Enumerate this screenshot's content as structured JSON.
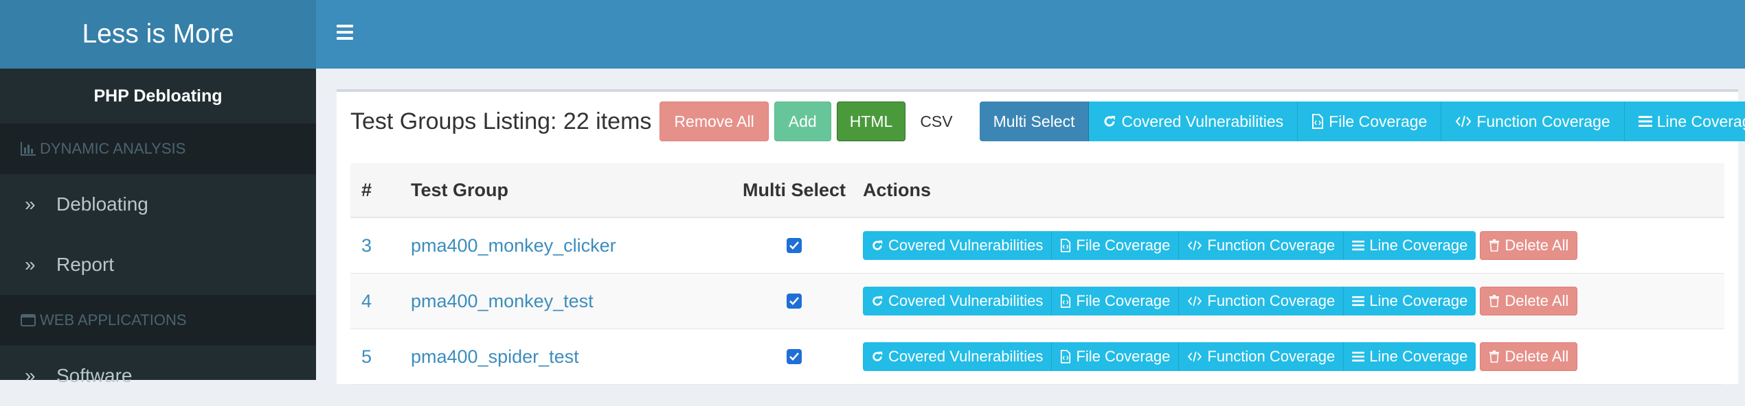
{
  "logo": {
    "text": "Less is More"
  },
  "sidebar": {
    "title": "PHP Debloating",
    "sections": [
      {
        "header": "DYNAMIC ANALYSIS",
        "icon": "bar-chart-icon",
        "items": [
          {
            "label": "Debloating",
            "icon": "double-chevron-right-icon"
          },
          {
            "label": "Report",
            "icon": "double-chevron-right-icon"
          }
        ]
      },
      {
        "header": "WEB APPLICATIONS",
        "icon": "window-icon",
        "items": [
          {
            "label": "Software",
            "icon": "double-chevron-right-icon"
          }
        ]
      }
    ]
  },
  "topbar": {
    "menu_icon": "hamburger-menu-icon"
  },
  "toolbar": {
    "title": "Test Groups Listing: 22 items",
    "remove_all": "Remove All",
    "add": "Add",
    "html": "HTML",
    "csv": "CSV",
    "multi_select": "Multi Select",
    "covered_vulnerabilities": "Covered Vulnerabilities",
    "file_coverage": "File Coverage",
    "function_coverage": "Function Coverage",
    "line_coverage": "Line Coverage"
  },
  "table": {
    "headers": {
      "num": "#",
      "group": "Test Group",
      "multi": "Multi Select",
      "actions": "Actions"
    },
    "action_labels": {
      "covered_vulnerabilities": "Covered Vulnerabilities",
      "file_coverage": "File Coverage",
      "function_coverage": "Function Coverage",
      "line_coverage": "Line Coverage",
      "delete_all": "Delete All"
    },
    "rows": [
      {
        "num": "3",
        "group": "pma400_monkey_clicker",
        "checked": true
      },
      {
        "num": "4",
        "group": "pma400_monkey_test",
        "checked": true
      },
      {
        "num": "5",
        "group": "pma400_spider_test",
        "checked": true
      }
    ]
  },
  "colors": {
    "logo_bg": "#367fa9",
    "topbar_bg": "#3c8dbc",
    "sidebar_bg": "#222d32",
    "info": "#22bce6",
    "danger": "#e6908a",
    "success": "#66c69a",
    "html_btn": "#4a9a3b"
  }
}
